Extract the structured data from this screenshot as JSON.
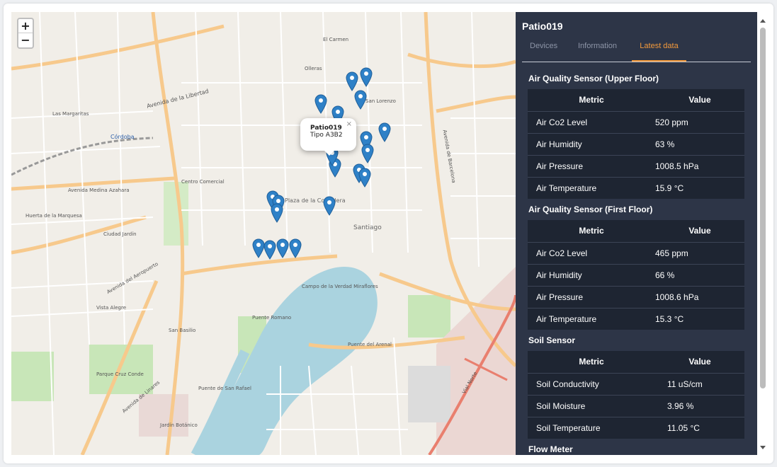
{
  "map": {
    "zoom_in": "+",
    "zoom_out": "−",
    "labels": [
      "Avenida de la Libertad",
      "Córdoba",
      "Las Margaritas",
      "Ciudad Jardín",
      "Centro Comercial",
      "Plaza de la Corredera",
      "Santiago",
      "San Lorenzo",
      "Puente Romano",
      "Puente de San Rafael",
      "Jardín Botánico",
      "Avenida del Aeropuerto",
      "Avenida de Linares",
      "Puente del Arenal",
      "Campo de la Verdad Miraflores",
      "Avenida Medina Azahara",
      "Huerta de la Marquesa",
      "Parque Cruz Conde",
      "Vista Alegre",
      "San Basilio",
      "Olleras",
      "El Carmen",
      "Avenida de Barcelona",
      "Vial Norte"
    ],
    "popup": {
      "title": "Patio019",
      "subtitle": "Tipo A3B2",
      "close": "×"
    }
  },
  "panel": {
    "title": "Patio019",
    "tabs": [
      "Devices",
      "Information",
      "Latest data"
    ],
    "active_tab": "Latest data",
    "sections": [
      {
        "title": "Air Quality Sensor (Upper Floor)",
        "headers": [
          "Metric",
          "Value"
        ],
        "rows": [
          [
            "Air Co2 Level",
            "520 ppm"
          ],
          [
            "Air Humidity",
            "63 %"
          ],
          [
            "Air Pressure",
            "1008.5 hPa"
          ],
          [
            "Air Temperature",
            "15.9 °C"
          ]
        ]
      },
      {
        "title": "Air Quality Sensor (First Floor)",
        "headers": [
          "Metric",
          "Value"
        ],
        "rows": [
          [
            "Air Co2 Level",
            "465 ppm"
          ],
          [
            "Air Humidity",
            "66 %"
          ],
          [
            "Air Pressure",
            "1008.6 hPa"
          ],
          [
            "Air Temperature",
            "15.3 °C"
          ]
        ]
      },
      {
        "title": "Soil Sensor",
        "headers": [
          "Metric",
          "Value"
        ],
        "rows": [
          [
            "Soil Conductivity",
            "11 uS/cm"
          ],
          [
            "Soil Moisture",
            "3.96 %"
          ],
          [
            "Soil Temperature",
            "11.05 °C"
          ]
        ]
      },
      {
        "title": "Flow Meter"
      }
    ]
  },
  "colors": {
    "panel_bg": "#2d3547",
    "table_bg": "#1e2532",
    "accent": "#f39a3c",
    "pin": "#2f81c7"
  }
}
